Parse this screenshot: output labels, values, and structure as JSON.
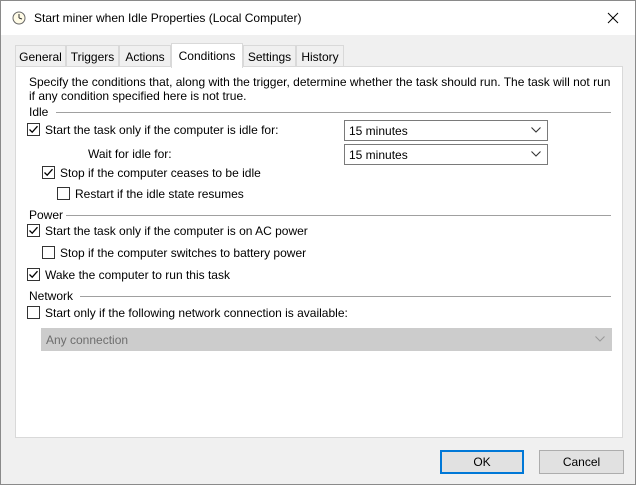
{
  "window": {
    "title": "Start miner when Idle Properties (Local Computer)"
  },
  "tabs": [
    {
      "label": "General"
    },
    {
      "label": "Triggers"
    },
    {
      "label": "Actions"
    },
    {
      "label": "Conditions"
    },
    {
      "label": "Settings"
    },
    {
      "label": "History"
    }
  ],
  "active_tab": "Conditions",
  "description": "Specify the conditions that, along with the trigger, determine whether the task should run.  The task will not run  if any condition specified here is not true.",
  "idle": {
    "group_label": "Idle",
    "start_if_idle": {
      "label": "Start the task only if the computer is idle for:",
      "checked": true
    },
    "idle_duration": "15 minutes",
    "wait_label": "Wait for idle for:",
    "wait_duration": "15 minutes",
    "stop_if_not_idle": {
      "label": "Stop if the computer ceases to be idle",
      "checked": true
    },
    "restart_if_idle": {
      "label": "Restart if the idle state resumes",
      "checked": false
    }
  },
  "power": {
    "group_label": "Power",
    "ac_power": {
      "label": "Start the task only if the computer is on AC power",
      "checked": true
    },
    "battery_stop": {
      "label": "Stop if the computer switches to battery power",
      "checked": false
    },
    "wake": {
      "label": "Wake the computer to run this task",
      "checked": true
    }
  },
  "network": {
    "group_label": "Network",
    "network_only": {
      "label": "Start only if the following network connection is available:",
      "checked": false
    },
    "connection": "Any connection"
  },
  "buttons": {
    "ok": "OK",
    "cancel": "Cancel"
  }
}
